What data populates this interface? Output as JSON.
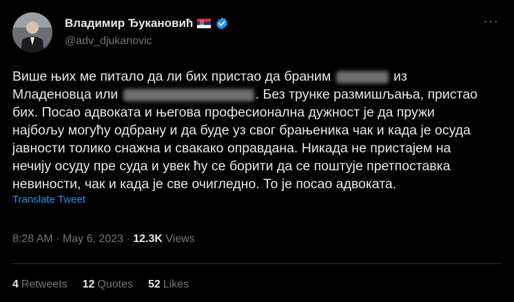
{
  "author": {
    "display_name": "Владимир Ђукановић",
    "handle": "@adv_djukanovic",
    "flag_icon": "serbia-flag-icon",
    "verified_icon": "verified-badge-icon"
  },
  "tweet": {
    "line1_a": "Више њих ме питало да ли бих пристао да браним",
    "line1_b": "из",
    "line2_a": "Младеновца или",
    "line2_b": ". Без трунке размишљања, пристао",
    "line3": "бих. Посао адвоката и његова професионална дужност је да пружи",
    "line4": "најбољу могућу одбрану и да буде уз свог брањеника чак и када је осуда",
    "line5": "јавности толико снажна и свакако оправдана. Никада не пристајем на",
    "line6": "нечију осуду пре суда и увек ћу се борити да се поштује претпоставка",
    "line7": "невиности, чак и када је све очигледно. То је посао адвоката.",
    "translate_label": "Translate Tweet"
  },
  "meta": {
    "time": "8:28 AM",
    "separator": "·",
    "date": "May 6, 2023",
    "views_count": "12.3K",
    "views_label": "Views"
  },
  "stats": {
    "retweets_count": "4",
    "retweets_label": "Retweets",
    "quotes_count": "12",
    "quotes_label": "Quotes",
    "likes_count": "52",
    "likes_label": "Likes"
  },
  "colors": {
    "background": "#000000",
    "text": "#e7e9ea",
    "secondary": "#71767b",
    "link": "#1d9bf0"
  }
}
